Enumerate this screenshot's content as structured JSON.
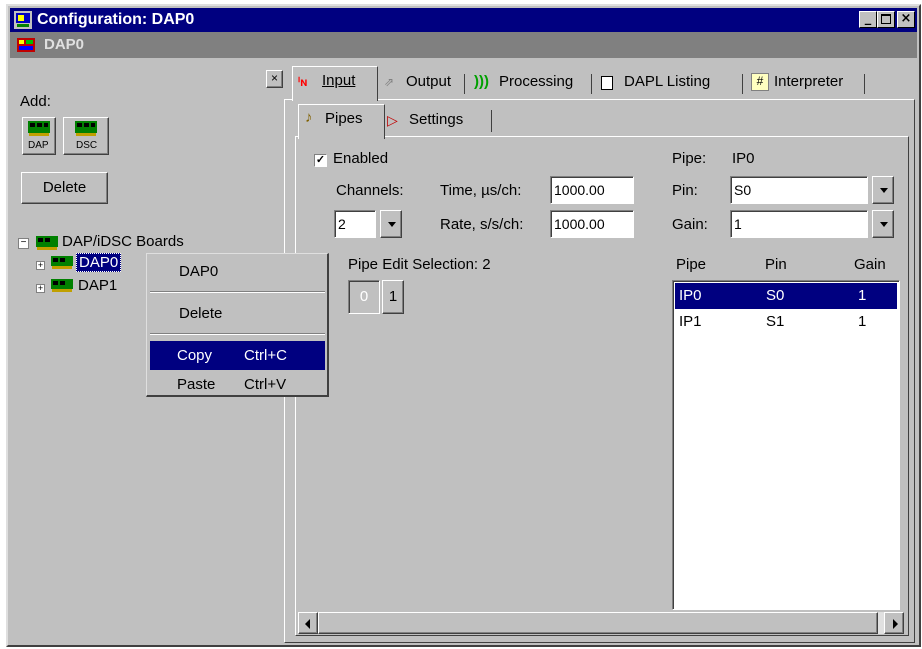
{
  "window": {
    "title": "Configuration: DAP0",
    "subtitle": "DAP0"
  },
  "left_panel": {
    "add_label": "Add:",
    "add_buttons": [
      {
        "label": "DAP"
      },
      {
        "label": "DSC"
      }
    ],
    "delete_label": "Delete",
    "close_glyph": "×",
    "tree": {
      "root": {
        "label": "DAP/iDSC Boards",
        "expander": "−"
      },
      "children": [
        {
          "label": "DAP0",
          "expander": "+",
          "selected": true
        },
        {
          "label": "DAP1",
          "expander": "+",
          "selected": false
        }
      ]
    }
  },
  "context_menu": {
    "header": "DAP0",
    "items": [
      {
        "label": "Delete",
        "shortcut": ""
      },
      {
        "label": "Copy",
        "shortcut": "Ctrl+C",
        "highlighted": true
      },
      {
        "label": "Paste",
        "shortcut": "Ctrl+V",
        "highlighted": false
      }
    ]
  },
  "tabs": [
    {
      "label": "Input",
      "active": true,
      "icon": "input-icon"
    },
    {
      "label": "Output",
      "active": false,
      "icon": "output-icon"
    },
    {
      "label": "Processing",
      "active": false,
      "icon": "processing-icon"
    },
    {
      "label": "DAPL Listing",
      "active": false,
      "icon": "listing-icon"
    },
    {
      "label": "Interpreter",
      "active": false,
      "icon": "interpreter-icon"
    }
  ],
  "subtabs": [
    {
      "label": "Pipes",
      "active": true,
      "icon": "pipes-icon"
    },
    {
      "label": "Settings",
      "active": false,
      "icon": "settings-icon"
    }
  ],
  "pipes": {
    "enabled_label": "Enabled",
    "enabled_checked": true,
    "channels_label": "Channels:",
    "channels_value": "2",
    "time_label": "Time, µs/ch:",
    "time_value": "1000.00",
    "rate_label": "Rate, s/s/ch:",
    "rate_value": "1000.00",
    "pipe_label": "Pipe:",
    "pipe_value": "IP0",
    "pin_label": "Pin:",
    "pin_value": "S0",
    "gain_label": "Gain:",
    "gain_value": "1",
    "edit_selection_label": "Pipe Edit Selection: 2",
    "selection_buttons": [
      "0",
      "1"
    ],
    "list": {
      "headers": [
        "Pipe",
        "Pin",
        "Gain"
      ],
      "rows": [
        {
          "pipe": "IP0",
          "pin": "S0",
          "gain": "1",
          "selected": true
        },
        {
          "pipe": "IP1",
          "pin": "S1",
          "gain": "1",
          "selected": false
        }
      ]
    }
  },
  "colors": {
    "selection": "#000080",
    "face": "#c0c0c0",
    "title": "#000080"
  }
}
